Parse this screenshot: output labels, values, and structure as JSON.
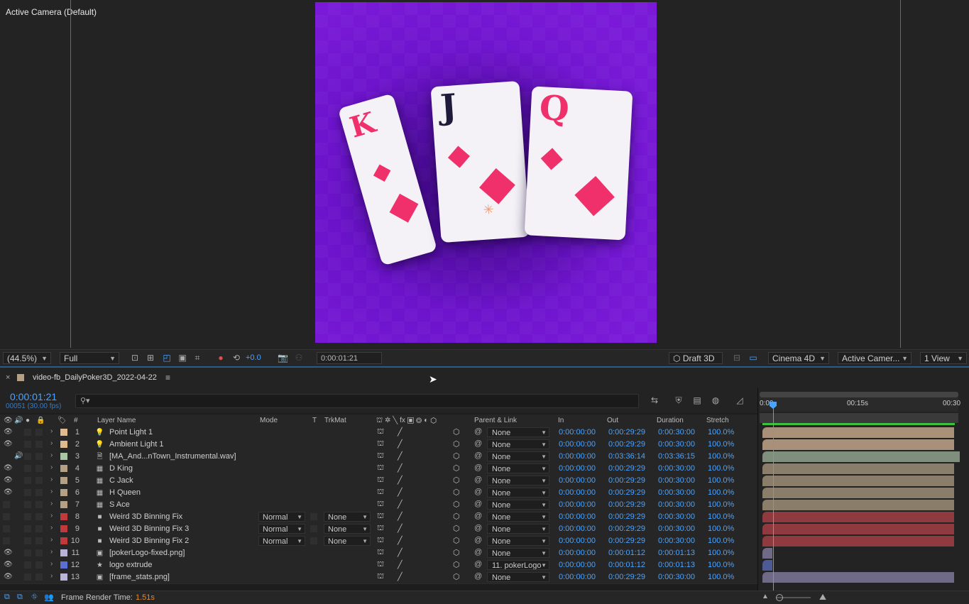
{
  "viewer": {
    "camera_label": "Active Camera (Default)",
    "cards": [
      {
        "rank": "K",
        "rank_color": "#f0306a"
      },
      {
        "rank": "J",
        "rank_color": "#1e1a3a"
      },
      {
        "rank": "Q",
        "rank_color": "#f0306a"
      }
    ]
  },
  "viewer_toolbar": {
    "zoom": "(44.5%)",
    "resolution": "Full",
    "exposure": "+0.0",
    "timecode": "0:00:01:21",
    "draft3d": "Draft 3D",
    "renderer": "Cinema 4D",
    "camera": "Active Camer...",
    "views": "1 View"
  },
  "panel": {
    "comp_name": "video-fb_DailyPoker3D_2022-04-22",
    "timecode": "0:00:01:21",
    "frame_info": "00051 (30.00 fps)",
    "ruler": [
      "0:00",
      "00:15s",
      "00:30"
    ]
  },
  "columns": {
    "num": "#",
    "layer_name": "Layer Name",
    "mode": "Mode",
    "t": "T",
    "trkmat": "TrkMat",
    "parent": "Parent & Link",
    "in": "In",
    "out": "Out",
    "duration": "Duration",
    "stretch": "Stretch"
  },
  "layers": [
    {
      "num": "1",
      "name": "Point Light 1",
      "color": "#e0b98f",
      "icon": "light-icon",
      "mode": "",
      "trkmat": "",
      "parent": "None",
      "in": "0:00:00:00",
      "out": "0:00:29:29",
      "duration": "0:00:30:00",
      "stretch": "100.0%",
      "bar": "#a99078",
      "bar_end": 0.97
    },
    {
      "num": "2",
      "name": "Ambient Light 1",
      "color": "#e0b98f",
      "icon": "light-icon",
      "mode": "",
      "trkmat": "",
      "parent": "None",
      "in": "0:00:00:00",
      "out": "0:00:29:29",
      "duration": "0:00:30:00",
      "stretch": "100.0%",
      "bar": "#a99078",
      "bar_end": 0.97
    },
    {
      "num": "3",
      "name": "[MA_And...nTown_Instrumental.wav]",
      "color": "#a9c7a6",
      "icon": "audio-icon",
      "mode": "",
      "trkmat": "",
      "parent": "None",
      "in": "0:00:00:00",
      "out": "0:03:36:14",
      "duration": "0:03:36:15",
      "stretch": "100.0%",
      "bar": "#7f8e7d",
      "bar_end": 1.0
    },
    {
      "num": "4",
      "name": "D King",
      "color": "#b4a085",
      "icon": "comp-icon",
      "mode": "",
      "trkmat": "",
      "parent": "None",
      "in": "0:00:00:00",
      "out": "0:00:29:29",
      "duration": "0:00:30:00",
      "stretch": "100.0%",
      "bar": "#8a7e6a",
      "bar_end": 0.97
    },
    {
      "num": "5",
      "name": "C Jack",
      "color": "#b4a085",
      "icon": "comp-icon",
      "mode": "",
      "trkmat": "",
      "parent": "None",
      "in": "0:00:00:00",
      "out": "0:00:29:29",
      "duration": "0:00:30:00",
      "stretch": "100.0%",
      "bar": "#8a7e6a",
      "bar_end": 0.97
    },
    {
      "num": "6",
      "name": "H Queen",
      "color": "#b4a085",
      "icon": "comp-icon",
      "mode": "",
      "trkmat": "",
      "parent": "None",
      "in": "0:00:00:00",
      "out": "0:00:29:29",
      "duration": "0:00:30:00",
      "stretch": "100.0%",
      "bar": "#8a7e6a",
      "bar_end": 0.97
    },
    {
      "num": "7",
      "name": "S Ace",
      "color": "#b4a085",
      "icon": "comp-icon",
      "mode": "",
      "trkmat": "",
      "parent": "None",
      "in": "0:00:00:00",
      "out": "0:00:29:29",
      "duration": "0:00:30:00",
      "stretch": "100.0%",
      "bar": "#8a7e6a",
      "bar_end": 0.97
    },
    {
      "num": "8",
      "name": "Weird 3D Binning Fix",
      "color": "#c0393b",
      "icon": "solid-icon",
      "mode": "Normal",
      "trkmat": "None",
      "parent": "None",
      "in": "0:00:00:00",
      "out": "0:00:29:29",
      "duration": "0:00:30:00",
      "stretch": "100.0%",
      "bar": "#8e3a3e",
      "bar_end": 0.97
    },
    {
      "num": "9",
      "name": "Weird 3D Binning Fix 3",
      "color": "#c0393b",
      "icon": "solid-icon",
      "mode": "Normal",
      "trkmat": "None",
      "parent": "None",
      "in": "0:00:00:00",
      "out": "0:00:29:29",
      "duration": "0:00:30:00",
      "stretch": "100.0%",
      "bar": "#8e3a3e",
      "bar_end": 0.97
    },
    {
      "num": "10",
      "name": "Weird 3D Binning Fix 2",
      "color": "#c0393b",
      "icon": "solid-icon",
      "mode": "Normal",
      "trkmat": "None",
      "parent": "None",
      "in": "0:00:00:00",
      "out": "0:00:29:29",
      "duration": "0:00:30:00",
      "stretch": "100.0%",
      "bar": "#8e3a3e",
      "bar_end": 0.97
    },
    {
      "num": "11",
      "name": "[pokerLogo-fixed.png]",
      "color": "#b9b2d9",
      "icon": "footage-icon",
      "mode": "",
      "trkmat": "",
      "parent": "None",
      "in": "0:00:00:00",
      "out": "0:00:01:12",
      "duration": "0:00:01:13",
      "stretch": "100.0%",
      "bar": "#6f6a86",
      "bar_end": 0.05
    },
    {
      "num": "12",
      "name": "logo extrude",
      "color": "#5a6fd8",
      "icon": "star-icon",
      "mode": "",
      "trkmat": "",
      "parent": "11. pokerLogo",
      "in": "0:00:00:00",
      "out": "0:00:01:12",
      "duration": "0:00:01:13",
      "stretch": "100.0%",
      "bar": "#4e5a95",
      "bar_end": 0.05
    },
    {
      "num": "13",
      "name": "[frame_stats.png]",
      "color": "#b9b2d9",
      "icon": "footage-icon",
      "mode": "",
      "trkmat": "",
      "parent": "None",
      "in": "0:00:00:00",
      "out": "0:00:29:29",
      "duration": "0:00:30:00",
      "stretch": "100.0%",
      "bar": "#6f6a86",
      "bar_end": 0.97
    }
  ],
  "footer": {
    "render_label": "Frame Render Time:",
    "render_value": "1.51s"
  }
}
